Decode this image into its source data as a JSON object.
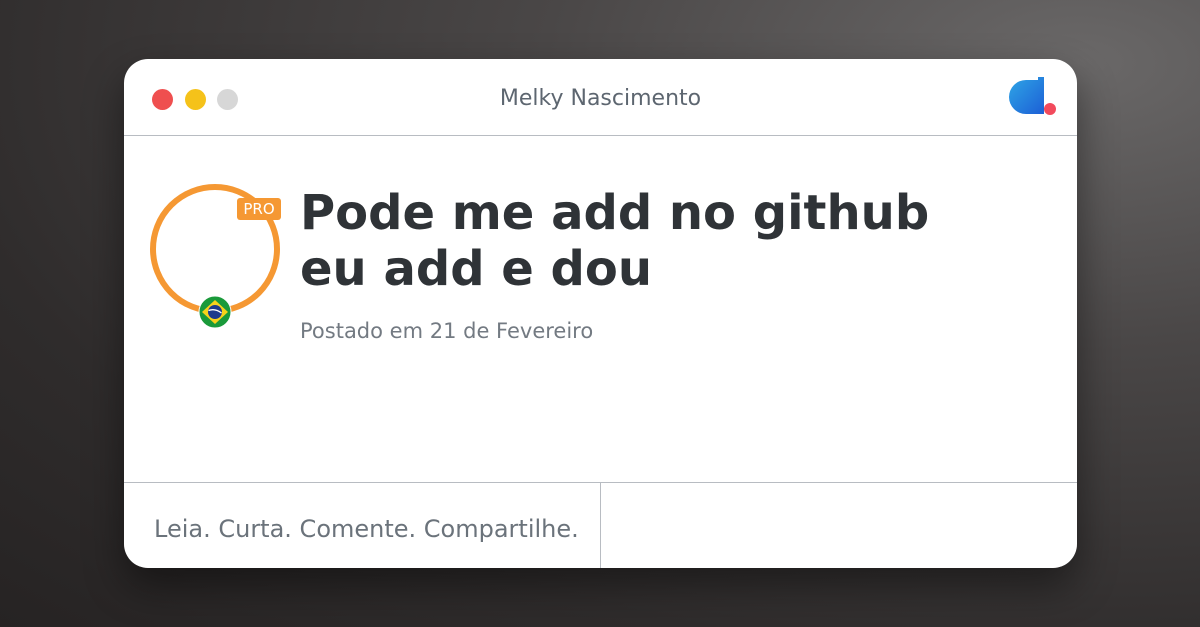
{
  "window": {
    "title": "Melky Nascimento",
    "controls": [
      "close-dot",
      "minimize-dot",
      "maximize-dot"
    ],
    "logo_icon": "dev-community-logo-icon"
  },
  "author": {
    "badge": "PRO",
    "country_flag_icon": "brazil-flag-icon"
  },
  "post": {
    "title": "Pode me add no github eu add e dou",
    "date": "Postado em 21 de Fevereiro"
  },
  "footer": {
    "tagline": "Leia. Curta. Comente. Compartilhe."
  },
  "colors": {
    "accent_orange": "#f59833",
    "close": "#ef4f4f",
    "minimize": "#f5c21a",
    "maximize": "#d7d7d7"
  }
}
